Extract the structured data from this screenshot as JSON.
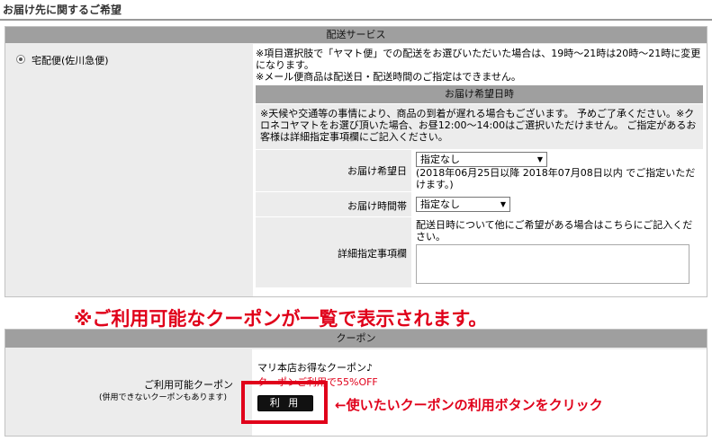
{
  "page": {
    "section_title": "お届け先に関するご希望"
  },
  "delivery": {
    "band_title": "配送サービス",
    "radio_label": "宅配便(佐川急便)",
    "note_1": "※項目選択肢で「ヤマト便」での配送をお選びいただいた場合は、19時〜21時は20時〜21時に変更になります。",
    "note_2": "※メール便商品は配送日・配送時間のご指定はできません。",
    "wish": {
      "band_title": "お届け希望日時",
      "notice": "※天候や交通等の事情により、商品の到着が遅れる場合もございます。 予めご了承ください。※クロネコヤマトをお選び頂いた場合、お昼12:00〜14:00はご選択いただけません。 ご指定があるお客様は詳細指定事項欄にご記入ください。",
      "date_label": "お届け希望日",
      "date_value": "指定なし",
      "date_range": "(2018年06月25日以降 2018年07月08日以内 でご指定いただけます。)",
      "time_label": "お届け時間帯",
      "time_value": "指定なし",
      "detail_label": "詳細指定事項欄",
      "detail_help": "配送日時について他にご希望がある場合はこちらにご記入ください。"
    }
  },
  "annotations": {
    "banner": "※ご利用可能なクーポンが一覧で表示されます。",
    "click_hint": "←使いたいクーポンの利用ボタンをクリック"
  },
  "coupon": {
    "band_title": "クーポン",
    "label": "ご利用可能クーポン",
    "sub_label": "(併用できないクーポンもあります)",
    "name": "マリ本店お得なクーポン♪",
    "discount": "クーポンご利用で55%OFF",
    "use_button": "利 用"
  },
  "colors": {
    "accent_red": "#e0001a",
    "band_gray": "#9f9f9f",
    "panel_gray": "#ececec"
  }
}
